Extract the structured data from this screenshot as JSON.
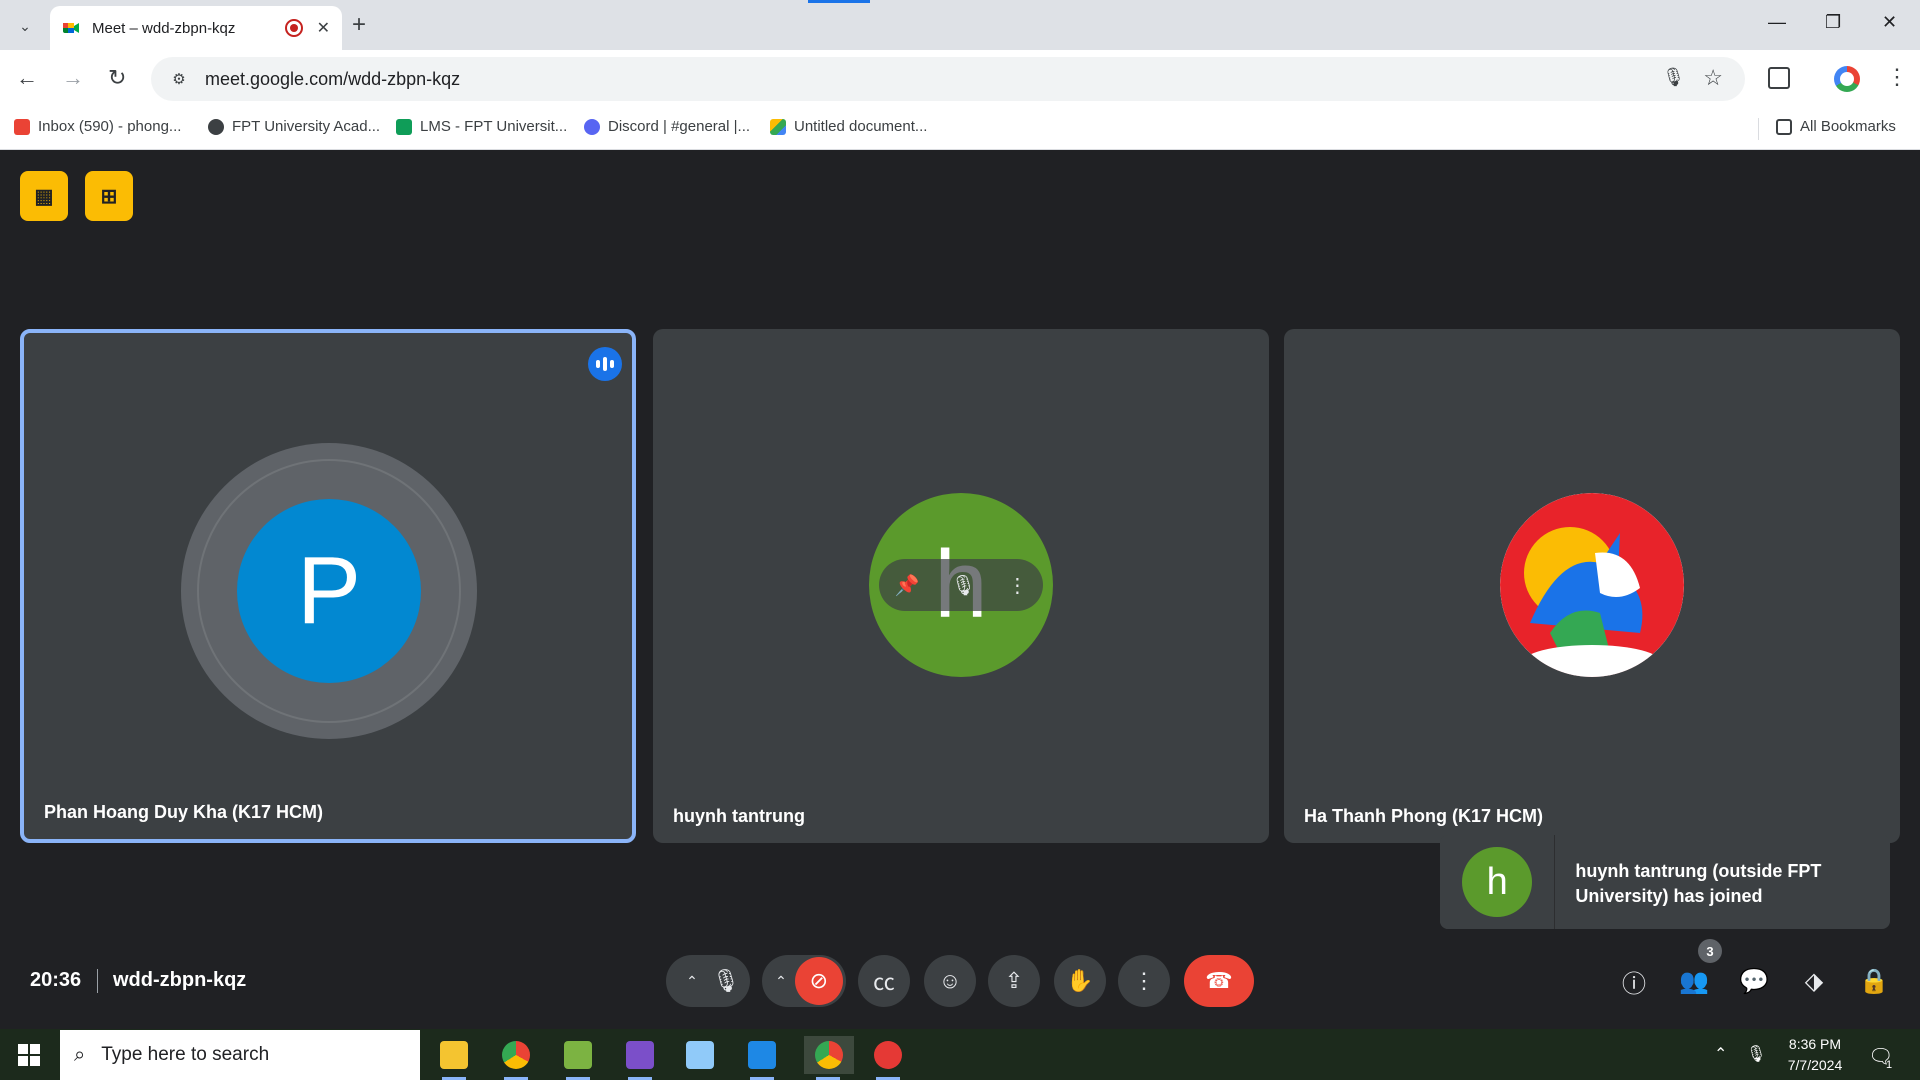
{
  "browser": {
    "tab_title": "Meet – wdd-zbpn-kqz",
    "url": "meet.google.com/wdd-zbpn-kqz",
    "bookmarks": [
      {
        "label": "Inbox (590) - phong...",
        "color": "#ea4335"
      },
      {
        "label": "FPT University Acad...",
        "color": "#3c4043"
      },
      {
        "label": "LMS - FPT Universit...",
        "color": "#0f9d58"
      },
      {
        "label": "Discord | #general |...",
        "color": "#5865f2"
      },
      {
        "label": "Untitled document...",
        "color": "#fbbc04"
      }
    ],
    "all_bookmarks_label": "All Bookmarks"
  },
  "meet": {
    "participants": [
      {
        "name": "Phan Hoang Duy Kha (K17 HCM)",
        "initial": "P",
        "avatar_color": "#0288d1",
        "speaking": true
      },
      {
        "name": "huynh tantrung",
        "initial": "h",
        "avatar_color": "#5b9a2c",
        "speaking": false
      },
      {
        "name": "Ha Thanh Phong (K17 HCM)",
        "initial": "",
        "avatar_icon": "unicorn-avatar",
        "speaking": false
      }
    ],
    "toast": {
      "initial": "h",
      "message": "huynh tantrung (outside FPT University) has joined"
    },
    "clock": "20:36",
    "meeting_code": "wdd-zbpn-kqz",
    "people_count": "3",
    "colors": {
      "end_call": "#ea4335",
      "active_border": "#8ab4f8",
      "tool_yellow": "#fbbc04"
    }
  },
  "taskbar": {
    "search_placeholder": "Type here to search",
    "time": "8:36 PM",
    "date": "7/7/2024",
    "notification_count": "1"
  }
}
